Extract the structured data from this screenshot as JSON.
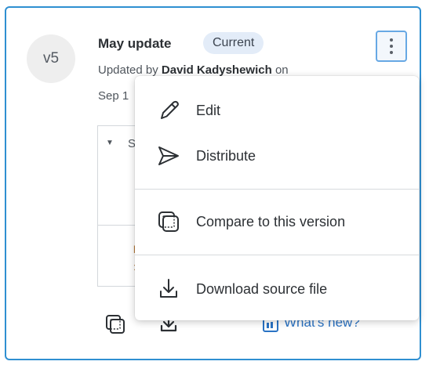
{
  "version": {
    "badge": "v5",
    "title": "May update",
    "status_pill": "Current",
    "updated_prefix": "Updated by ",
    "updated_author": "David Kadyshewich",
    "updated_suffix": " on",
    "updated_date_partial": "Sep 1",
    "accent_color": "#2f8fd1"
  },
  "inner_panel": {
    "collapsed_label_partial": "S"
  },
  "footer": {
    "whats_new_label": "What's new?",
    "compare_icon": "compare-versions-icon",
    "download_icon": "download-icon",
    "whats_new_icon": "announcement-icon"
  },
  "menu": {
    "items": [
      {
        "label": "Edit",
        "icon": "pencil-icon"
      },
      {
        "label": "Distribute",
        "icon": "send-icon"
      },
      {
        "label": "Compare to this version",
        "icon": "compare-versions-icon"
      },
      {
        "label": "Download source file",
        "icon": "download-icon"
      }
    ]
  }
}
